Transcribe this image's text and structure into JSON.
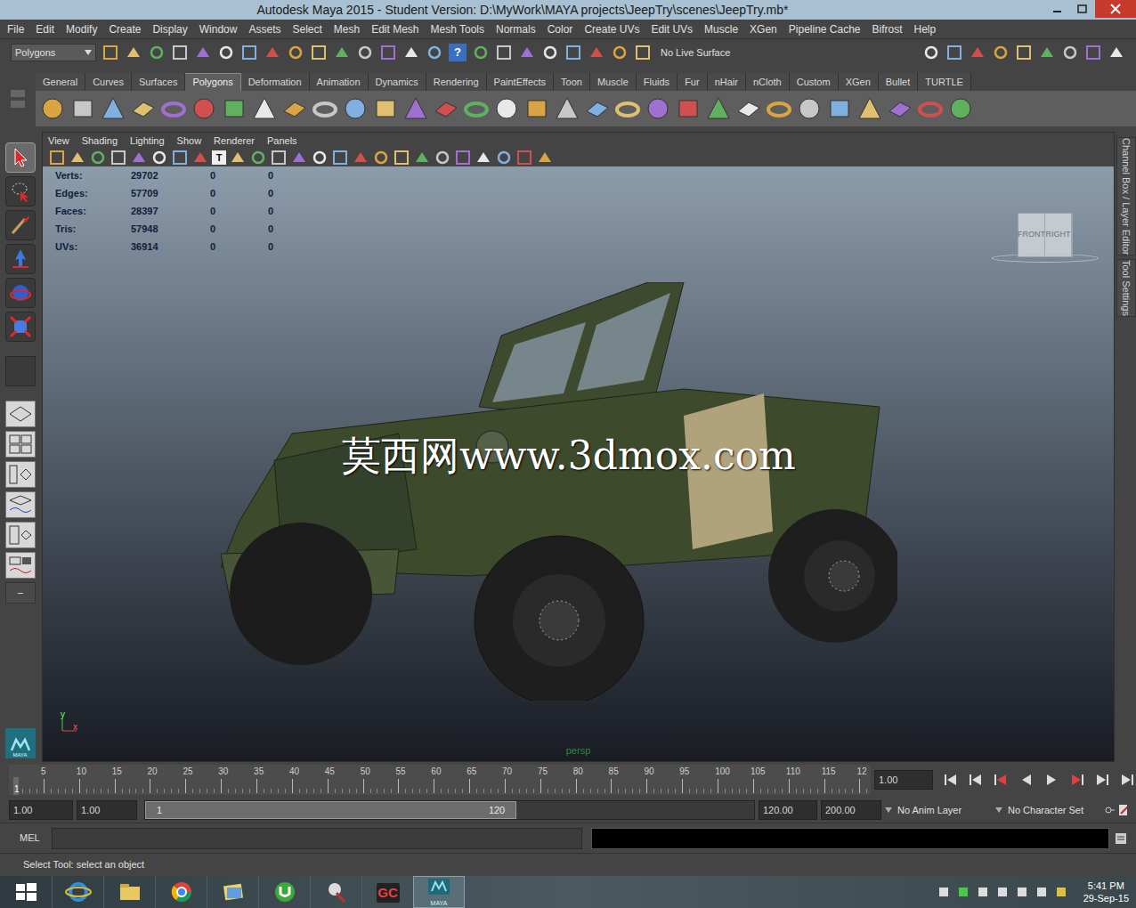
{
  "window": {
    "title": "Autodesk Maya 2015 - Student Version: D:\\MyWork\\MAYA projects\\JeepTry\\scenes\\JeepTry.mb*"
  },
  "menu_bar": [
    "File",
    "Edit",
    "Modify",
    "Create",
    "Display",
    "Window",
    "Assets",
    "Select",
    "Mesh",
    "Edit Mesh",
    "Mesh Tools",
    "Normals",
    "Color",
    "Create UVs",
    "Edit UVs",
    "Muscle",
    "XGen",
    "Pipeline Cache",
    "Bifrost",
    "Help"
  ],
  "status_line": {
    "mode": "Polygons",
    "help": "?",
    "live_surface": "No Live Surface"
  },
  "shelf": {
    "tabs": [
      {
        "label": "General",
        "selected": false
      },
      {
        "label": "Curves",
        "selected": false
      },
      {
        "label": "Surfaces",
        "selected": false
      },
      {
        "label": "Polygons",
        "selected": true
      },
      {
        "label": "Deformation",
        "selected": false
      },
      {
        "label": "Animation",
        "selected": false
      },
      {
        "label": "Dynamics",
        "selected": false
      },
      {
        "label": "Rendering",
        "selected": false
      },
      {
        "label": "PaintEffects",
        "selected": false
      },
      {
        "label": "Toon",
        "selected": false
      },
      {
        "label": "Muscle",
        "selected": false
      },
      {
        "label": "Fluids",
        "selected": false
      },
      {
        "label": "Fur",
        "selected": false
      },
      {
        "label": "nHair",
        "selected": false
      },
      {
        "label": "nCloth",
        "selected": false
      },
      {
        "label": "Custom",
        "selected": false
      },
      {
        "label": "XGen",
        "selected": false
      },
      {
        "label": "Bullet",
        "selected": false
      },
      {
        "label": "TURTLE",
        "selected": false
      }
    ]
  },
  "toolbox": [
    {
      "kind": "select",
      "selected": true
    },
    {
      "kind": "lasso",
      "selected": false
    },
    {
      "kind": "paint",
      "selected": false
    },
    {
      "kind": "move",
      "selected": false
    },
    {
      "kind": "rotate",
      "selected": false
    },
    {
      "kind": "scale",
      "selected": false
    }
  ],
  "panel_menu": [
    "View",
    "Shading",
    "Lighting",
    "Show",
    "Renderer",
    "Panels"
  ],
  "viewport_toolbar": {
    "text_icon": "T"
  },
  "viewport": {
    "hud": [
      {
        "label": "Verts:",
        "values": [
          "29702",
          "0",
          "0"
        ]
      },
      {
        "label": "Edges:",
        "values": [
          "57709",
          "0",
          "0"
        ]
      },
      {
        "label": "Faces:",
        "values": [
          "28397",
          "0",
          "0"
        ]
      },
      {
        "label": "Tris:",
        "values": [
          "57948",
          "0",
          "0"
        ]
      },
      {
        "label": "UVs:",
        "values": [
          "36914",
          "0",
          "0"
        ]
      }
    ],
    "view_cube": [
      "FRONT",
      "RIGHT"
    ],
    "camera": "persp",
    "axes": {
      "up": "y",
      "side": "x"
    },
    "watermark": "莫西网www.3dmox.com"
  },
  "side_tabs": [
    "Channel Box / Layer Editor",
    "Tool Settings"
  ],
  "time_slider": {
    "ticks": [
      "5",
      "10",
      "15",
      "20",
      "25",
      "30",
      "35",
      "40",
      "45",
      "50",
      "55",
      "60",
      "65",
      "70",
      "75",
      "80",
      "85",
      "90",
      "95",
      "100",
      "105",
      "110",
      "115",
      "12"
    ],
    "current_frame": "1",
    "frame_field": "1.00"
  },
  "range_slider": {
    "start": "1.00",
    "playback_start": "1.00",
    "range_start": "1",
    "range_end": "120",
    "level": 0.61,
    "playback_end": "120.00",
    "end": "200.00",
    "anim_layer": "No Anim Layer",
    "character_set": "No Character Set"
  },
  "command_line": {
    "language": "MEL"
  },
  "help_line": "Select Tool: select an object",
  "maya_logo": "MAYA",
  "taskbar": {
    "apps": [
      {
        "kind": "start",
        "label": "",
        "selected": false
      },
      {
        "kind": "ie",
        "label": "",
        "selected": false
      },
      {
        "kind": "explorer",
        "label": "",
        "selected": false
      },
      {
        "kind": "chrome",
        "label": "",
        "selected": false
      },
      {
        "kind": "folder",
        "label": "",
        "selected": false
      },
      {
        "kind": "torrent",
        "label": "",
        "selected": false
      },
      {
        "kind": "tool",
        "label": "",
        "selected": false
      },
      {
        "kind": "text",
        "label": "GC",
        "selected": false
      },
      {
        "kind": "maya",
        "label": "MAYA",
        "selected": true
      }
    ],
    "time": "5:41 PM",
    "date": "29-Sep-15"
  }
}
